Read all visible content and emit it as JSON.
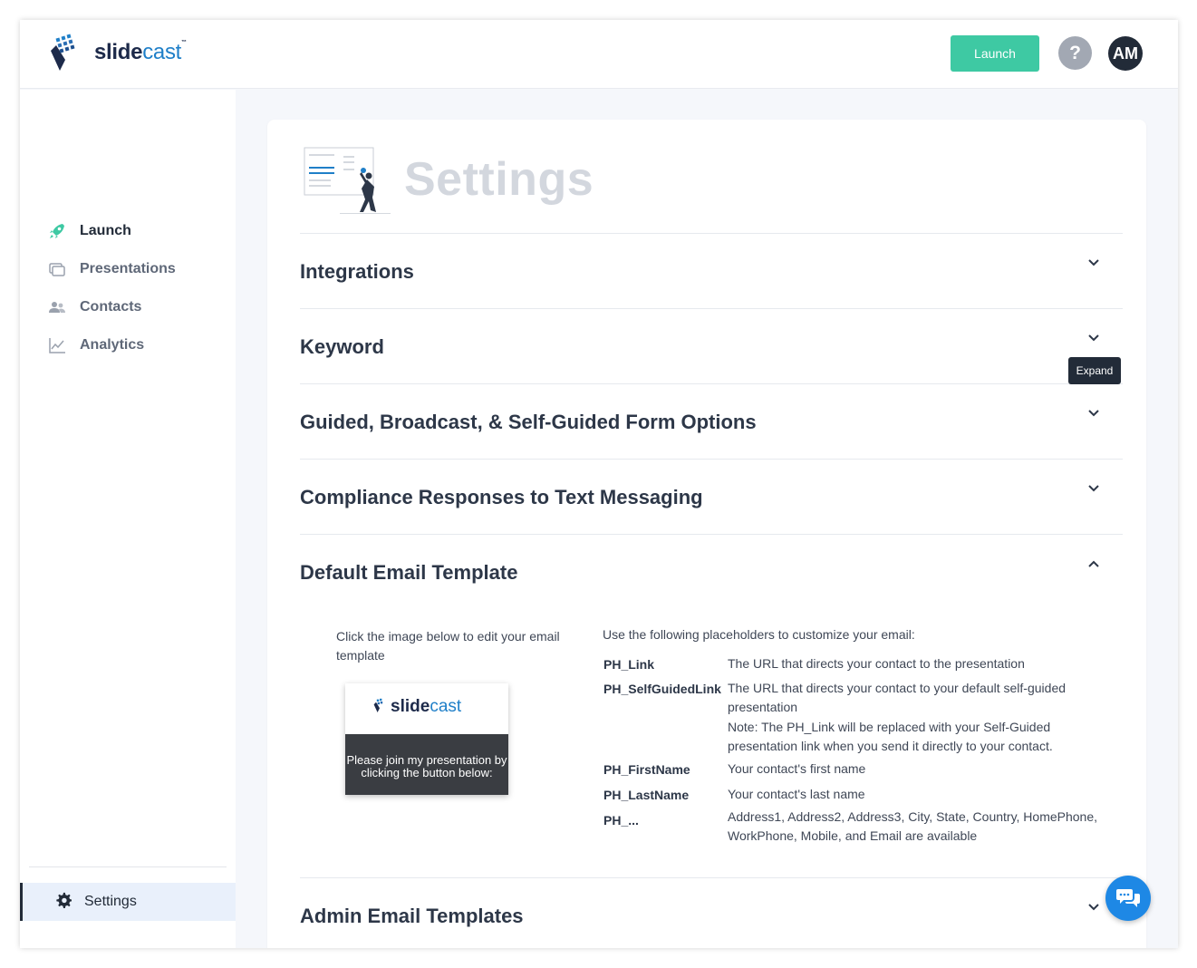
{
  "brand": {
    "name_part1": "slide",
    "name_part2": "cast",
    "trademark": "™"
  },
  "header": {
    "launch_label": "Launch",
    "help_label": "?",
    "avatar_initials": "AM"
  },
  "sidebar": {
    "items": [
      {
        "label": "Launch",
        "icon": "rocket-icon"
      },
      {
        "label": "Presentations",
        "icon": "presentations-icon"
      },
      {
        "label": "Contacts",
        "icon": "contacts-icon"
      },
      {
        "label": "Analytics",
        "icon": "analytics-icon"
      }
    ],
    "settings_label": "Settings"
  },
  "page": {
    "title": "Settings"
  },
  "sections": [
    {
      "title": "Integrations",
      "state": "collapsed"
    },
    {
      "title": "Keyword",
      "state": "collapsed"
    },
    {
      "title": "Guided, Broadcast, & Self-Guided Form Options",
      "state": "collapsed"
    },
    {
      "title": "Compliance Responses to Text Messaging",
      "state": "collapsed"
    },
    {
      "title": "Default Email Template",
      "state": "expanded"
    },
    {
      "title": "Admin Email Templates",
      "state": "collapsed"
    }
  ],
  "tooltip": "Expand",
  "email_template": {
    "instruction": "Click the image below to edit your email template",
    "thumbnail_text": "Please join my presentation by clicking the button below:",
    "placeholder_intro": "Use the following placeholders to customize your email:",
    "placeholders": [
      {
        "key": "PH_Link",
        "desc": "The URL that directs your contact to the presentation"
      },
      {
        "key": "PH_SelfGuidedLink",
        "desc": "The URL that directs your contact to your default self-guided presentation",
        "note": "Note: The PH_Link will be replaced with your Self-Guided presentation link when you send it directly to your contact."
      },
      {
        "key": "PH_FirstName",
        "desc": "Your contact's first name"
      },
      {
        "key": "PH_LastName",
        "desc": "Your contact's last name"
      },
      {
        "key": "PH_...",
        "desc": "Address1, Address2, Address3, City, State, Country, HomePhone, WorkPhone, Mobile, and Email are available"
      }
    ]
  },
  "colors": {
    "accent": "#3ec9a3",
    "dark": "#222b38",
    "brand_blue": "#1f7fc8",
    "chat": "#1e88e5"
  }
}
